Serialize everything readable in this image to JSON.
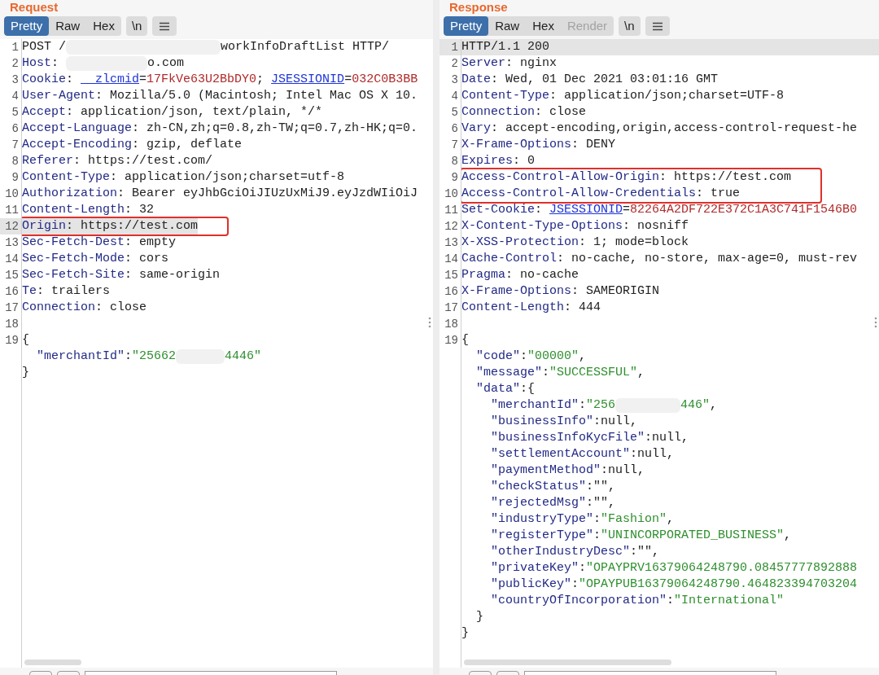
{
  "panels": [
    {
      "title": "Request",
      "tabs": [
        {
          "label": "Pretty",
          "selected": true,
          "disabled": false
        },
        {
          "label": "Raw",
          "selected": false,
          "disabled": false
        },
        {
          "label": "Hex",
          "selected": false,
          "disabled": false
        }
      ],
      "newline_button": "\\n",
      "lines": [
        {
          "n": "1",
          "highlighted": false,
          "boxed": false,
          "segments": [
            {
              "kind": "plain",
              "text": "POST /"
            },
            {
              "kind": "redacted"
            },
            {
              "kind": "plain",
              "text": "workInfoDraftList HTTP/"
            }
          ]
        },
        {
          "n": "2",
          "highlighted": false,
          "boxed": false,
          "segments": [
            {
              "kind": "key",
              "text": "Host"
            },
            {
              "kind": "plain",
              "text": ": "
            },
            {
              "kind": "redacted"
            },
            {
              "kind": "plain",
              "text": "o.com"
            }
          ]
        },
        {
          "n": "3",
          "highlighted": false,
          "boxed": false,
          "segments": [
            {
              "kind": "key",
              "text": "Cookie"
            },
            {
              "kind": "plain",
              "text": ": "
            },
            {
              "kind": "cookie-name",
              "text": "__zlcmid"
            },
            {
              "kind": "plain",
              "text": "="
            },
            {
              "kind": "cookie-value",
              "text": "17FkVe63U2BbDY0"
            },
            {
              "kind": "plain",
              "text": "; "
            },
            {
              "kind": "cookie-name",
              "text": "JSESSIONID"
            },
            {
              "kind": "plain",
              "text": "="
            },
            {
              "kind": "cookie-value",
              "text": "032C0B3BB"
            }
          ]
        },
        {
          "n": "4",
          "highlighted": false,
          "boxed": false,
          "segments": [
            {
              "kind": "key",
              "text": "User-Agent"
            },
            {
              "kind": "plain",
              "text": ": Mozilla/5.0 (Macintosh; Intel Mac OS X 10."
            }
          ]
        },
        {
          "n": "5",
          "highlighted": false,
          "boxed": false,
          "segments": [
            {
              "kind": "key",
              "text": "Accept"
            },
            {
              "kind": "plain",
              "text": ": application/json, text/plain, */*"
            }
          ]
        },
        {
          "n": "6",
          "highlighted": false,
          "boxed": false,
          "segments": [
            {
              "kind": "key",
              "text": "Accept-Language"
            },
            {
              "kind": "plain",
              "text": ": zh-CN,zh;q=0.8,zh-TW;q=0.7,zh-HK;q=0."
            }
          ]
        },
        {
          "n": "7",
          "highlighted": false,
          "boxed": false,
          "segments": [
            {
              "kind": "key",
              "text": "Accept-Encoding"
            },
            {
              "kind": "plain",
              "text": ": gzip, deflate"
            }
          ]
        },
        {
          "n": "8",
          "highlighted": false,
          "boxed": false,
          "segments": [
            {
              "kind": "key",
              "text": "Referer"
            },
            {
              "kind": "plain",
              "text": ": https://test.com/"
            }
          ]
        },
        {
          "n": "9",
          "highlighted": false,
          "boxed": false,
          "segments": [
            {
              "kind": "key",
              "text": "Content-Type"
            },
            {
              "kind": "plain",
              "text": ": application/json;charset=utf-8"
            }
          ]
        },
        {
          "n": "10",
          "highlighted": false,
          "boxed": false,
          "segments": [
            {
              "kind": "key",
              "text": "Authorization"
            },
            {
              "kind": "plain",
              "text": ": Bearer eyJhbGciOiJIUzUxMiJ9.eyJzdWIiOiJ"
            }
          ]
        },
        {
          "n": "11",
          "highlighted": false,
          "boxed": false,
          "segments": [
            {
              "kind": "key",
              "text": "Content-Length"
            },
            {
              "kind": "plain",
              "text": ": 32"
            }
          ]
        },
        {
          "n": "12",
          "highlighted": true,
          "boxed": true,
          "segments": [
            {
              "kind": "key",
              "text": "Origin"
            },
            {
              "kind": "plain",
              "text": ": https://test.com"
            }
          ]
        },
        {
          "n": "13",
          "highlighted": false,
          "boxed": false,
          "segments": [
            {
              "kind": "key",
              "text": "Sec-Fetch-Dest"
            },
            {
              "kind": "plain",
              "text": ": empty"
            }
          ]
        },
        {
          "n": "14",
          "highlighted": false,
          "boxed": false,
          "segments": [
            {
              "kind": "key",
              "text": "Sec-Fetch-Mode"
            },
            {
              "kind": "plain",
              "text": ": cors"
            }
          ]
        },
        {
          "n": "15",
          "highlighted": false,
          "boxed": false,
          "segments": [
            {
              "kind": "key",
              "text": "Sec-Fetch-Site"
            },
            {
              "kind": "plain",
              "text": ": same-origin"
            }
          ]
        },
        {
          "n": "16",
          "highlighted": false,
          "boxed": false,
          "segments": [
            {
              "kind": "key",
              "text": "Te"
            },
            {
              "kind": "plain",
              "text": ": trailers"
            }
          ]
        },
        {
          "n": "17",
          "highlighted": false,
          "boxed": false,
          "segments": [
            {
              "kind": "key",
              "text": "Connection"
            },
            {
              "kind": "plain",
              "text": ": close"
            }
          ]
        },
        {
          "n": "18",
          "highlighted": false,
          "boxed": false
        },
        {
          "n": "19",
          "highlighted": false,
          "boxed": false,
          "segments": [
            {
              "kind": "plain",
              "text": "{"
            }
          ],
          "children": [
            {
              "highlighted": false,
              "boxed": false,
              "segments": [
                {
                  "kind": "key",
                  "text": "\"merchantId\""
                },
                {
                  "kind": "plain",
                  "text": ":"
                },
                {
                  "kind": "string",
                  "text": "\"25662"
                },
                {
                  "kind": "redacted"
                },
                {
                  "kind": "string",
                  "text": "4446\""
                }
              ]
            }
          ]
        },
        {
          "highlighted": false,
          "boxed": false,
          "segments": [
            {
              "kind": "plain",
              "text": "}"
            }
          ]
        }
      ]
    },
    {
      "title": "Response",
      "tabs": [
        {
          "label": "Pretty",
          "selected": true,
          "disabled": false
        },
        {
          "label": "Raw",
          "selected": false,
          "disabled": false
        },
        {
          "label": "Hex",
          "selected": false,
          "disabled": false
        },
        {
          "label": "Render",
          "selected": false,
          "disabled": true
        }
      ],
      "newline_button": "\\n",
      "lines": [
        {
          "n": "1",
          "highlighted": true,
          "boxed": false,
          "segments": [
            {
              "kind": "plain",
              "text": "HTTP/1.1 200"
            }
          ]
        },
        {
          "n": "2",
          "highlighted": false,
          "boxed": false,
          "segments": [
            {
              "kind": "key",
              "text": "Server"
            },
            {
              "kind": "plain",
              "text": ": nginx"
            }
          ]
        },
        {
          "n": "3",
          "highlighted": false,
          "boxed": false,
          "segments": [
            {
              "kind": "key",
              "text": "Date"
            },
            {
              "kind": "plain",
              "text": ": Wed, 01 Dec 2021 03:01:16 GMT"
            }
          ]
        },
        {
          "n": "4",
          "highlighted": false,
          "boxed": false,
          "segments": [
            {
              "kind": "key",
              "text": "Content-Type"
            },
            {
              "kind": "plain",
              "text": ": application/json;charset=UTF-8"
            }
          ]
        },
        {
          "n": "5",
          "highlighted": false,
          "boxed": false,
          "segments": [
            {
              "kind": "key",
              "text": "Connection"
            },
            {
              "kind": "plain",
              "text": ": close"
            }
          ]
        },
        {
          "n": "6",
          "highlighted": false,
          "boxed": false,
          "segments": [
            {
              "kind": "key",
              "text": "Vary"
            },
            {
              "kind": "plain",
              "text": ": accept-encoding,origin,access-control-request-he"
            }
          ]
        },
        {
          "n": "7",
          "highlighted": false,
          "boxed": false,
          "segments": [
            {
              "kind": "key",
              "text": "X-Frame-Options"
            },
            {
              "kind": "plain",
              "text": ": DENY"
            }
          ]
        },
        {
          "n": "8",
          "highlighted": false,
          "boxed": false,
          "segments": [
            {
              "kind": "key",
              "text": "Expires"
            },
            {
              "kind": "plain",
              "text": ": 0"
            }
          ]
        },
        {
          "n": "9",
          "highlighted": false,
          "boxed": true,
          "segments": [
            {
              "kind": "key",
              "text": "Access-Control-Allow-Origin"
            },
            {
              "kind": "plain",
              "text": ": https://test.com"
            }
          ]
        },
        {
          "n": "10",
          "highlighted": false,
          "boxed": true,
          "segments": [
            {
              "kind": "key",
              "text": "Access-Control-Allow-Credentials"
            },
            {
              "kind": "plain",
              "text": ": true"
            }
          ]
        },
        {
          "n": "11",
          "highlighted": false,
          "boxed": false,
          "segments": [
            {
              "kind": "key",
              "text": "Set-Cookie"
            },
            {
              "kind": "plain",
              "text": ": "
            },
            {
              "kind": "cookie-name",
              "text": "JSESSIONID"
            },
            {
              "kind": "plain",
              "text": "="
            },
            {
              "kind": "cookie-value",
              "text": "82264A2DF722E372C1A3C741F1546B0"
            }
          ]
        },
        {
          "n": "12",
          "highlighted": false,
          "boxed": false,
          "segments": [
            {
              "kind": "key",
              "text": "X-Content-Type-Options"
            },
            {
              "kind": "plain",
              "text": ": nosniff"
            }
          ]
        },
        {
          "n": "13",
          "highlighted": false,
          "boxed": false,
          "segments": [
            {
              "kind": "key",
              "text": "X-XSS-Protection"
            },
            {
              "kind": "plain",
              "text": ": 1; mode=block"
            }
          ]
        },
        {
          "n": "14",
          "highlighted": false,
          "boxed": false,
          "segments": [
            {
              "kind": "key",
              "text": "Cache-Control"
            },
            {
              "kind": "plain",
              "text": ": no-cache, no-store, max-age=0, must-rev"
            }
          ]
        },
        {
          "n": "15",
          "highlighted": false,
          "boxed": false,
          "segments": [
            {
              "kind": "key",
              "text": "Pragma"
            },
            {
              "kind": "plain",
              "text": ": no-cache"
            }
          ]
        },
        {
          "n": "16",
          "highlighted": false,
          "boxed": false,
          "segments": [
            {
              "kind": "key",
              "text": "X-Frame-Options"
            },
            {
              "kind": "plain",
              "text": ": SAMEORIGIN"
            }
          ]
        },
        {
          "n": "17",
          "highlighted": false,
          "boxed": false,
          "segments": [
            {
              "kind": "key",
              "text": "Content-Length"
            },
            {
              "kind": "plain",
              "text": ": 444"
            }
          ]
        },
        {
          "n": "18",
          "highlighted": false,
          "boxed": false
        },
        {
          "n": "19",
          "highlighted": false,
          "boxed": false,
          "segments": [
            {
              "kind": "plain",
              "text": "{"
            }
          ],
          "children": [
            {
              "highlighted": false,
              "boxed": false,
              "segments": [
                {
                  "kind": "key",
                  "text": "\"code\""
                },
                {
                  "kind": "plain",
                  "text": ":"
                },
                {
                  "kind": "string",
                  "text": "\"00000\""
                },
                {
                  "kind": "plain",
                  "text": ","
                }
              ]
            },
            {
              "highlighted": false,
              "boxed": false,
              "segments": [
                {
                  "kind": "key",
                  "text": "\"message\""
                },
                {
                  "kind": "plain",
                  "text": ":"
                },
                {
                  "kind": "string",
                  "text": "\"SUCCESSFUL\""
                },
                {
                  "kind": "plain",
                  "text": ","
                }
              ]
            },
            {
              "highlighted": false,
              "boxed": false,
              "segments": [
                {
                  "kind": "key",
                  "text": "\"data\""
                },
                {
                  "kind": "plain",
                  "text": ":{"
                }
              ],
              "children": [
                {
                  "highlighted": false,
                  "boxed": false,
                  "segments": [
                    {
                      "kind": "key",
                      "text": "\"merchantId\""
                    },
                    {
                      "kind": "plain",
                      "text": ":"
                    },
                    {
                      "kind": "string",
                      "text": "\"256"
                    },
                    {
                      "kind": "redacted"
                    },
                    {
                      "kind": "string",
                      "text": "446\""
                    },
                    {
                      "kind": "plain",
                      "text": ","
                    }
                  ]
                },
                {
                  "highlighted": false,
                  "boxed": false,
                  "segments": [
                    {
                      "kind": "key",
                      "text": "\"businessInfo\""
                    },
                    {
                      "kind": "plain",
                      "text": ":null,"
                    }
                  ]
                },
                {
                  "highlighted": false,
                  "boxed": false,
                  "segments": [
                    {
                      "kind": "key",
                      "text": "\"businessInfoKycFile\""
                    },
                    {
                      "kind": "plain",
                      "text": ":null,"
                    }
                  ]
                },
                {
                  "highlighted": false,
                  "boxed": false,
                  "segments": [
                    {
                      "kind": "key",
                      "text": "\"settlementAccount\""
                    },
                    {
                      "kind": "plain",
                      "text": ":null,"
                    }
                  ]
                },
                {
                  "highlighted": false,
                  "boxed": false,
                  "segments": [
                    {
                      "kind": "key",
                      "text": "\"paymentMethod\""
                    },
                    {
                      "kind": "plain",
                      "text": ":null,"
                    }
                  ]
                },
                {
                  "highlighted": false,
                  "boxed": false,
                  "segments": [
                    {
                      "kind": "key",
                      "text": "\"checkStatus\""
                    },
                    {
                      "kind": "plain",
                      "text": ":\"\","
                    }
                  ]
                },
                {
                  "highlighted": false,
                  "boxed": false,
                  "segments": [
                    {
                      "kind": "key",
                      "text": "\"rejectedMsg\""
                    },
                    {
                      "kind": "plain",
                      "text": ":\"\","
                    }
                  ]
                },
                {
                  "highlighted": false,
                  "boxed": false,
                  "segments": [
                    {
                      "kind": "key",
                      "text": "\"industryType\""
                    },
                    {
                      "kind": "plain",
                      "text": ":"
                    },
                    {
                      "kind": "string",
                      "text": "\"Fashion\""
                    },
                    {
                      "kind": "plain",
                      "text": ","
                    }
                  ]
                },
                {
                  "highlighted": false,
                  "boxed": false,
                  "segments": [
                    {
                      "kind": "key",
                      "text": "\"registerType\""
                    },
                    {
                      "kind": "plain",
                      "text": ":"
                    },
                    {
                      "kind": "string",
                      "text": "\"UNINCORPORATED_BUSINESS\""
                    },
                    {
                      "kind": "plain",
                      "text": ","
                    }
                  ]
                },
                {
                  "highlighted": false,
                  "boxed": false,
                  "segments": [
                    {
                      "kind": "key",
                      "text": "\"otherIndustryDesc\""
                    },
                    {
                      "kind": "plain",
                      "text": ":\"\","
                    }
                  ]
                },
                {
                  "highlighted": false,
                  "boxed": false,
                  "segments": [
                    {
                      "kind": "key",
                      "text": "\"privateKey\""
                    },
                    {
                      "kind": "plain",
                      "text": ":"
                    },
                    {
                      "kind": "string",
                      "text": "\"OPAYPRV16379064248790.08457777892888"
                    }
                  ]
                },
                {
                  "highlighted": false,
                  "boxed": false,
                  "segments": [
                    {
                      "kind": "key",
                      "text": "\"publicKey\""
                    },
                    {
                      "kind": "plain",
                      "text": ":"
                    },
                    {
                      "kind": "string",
                      "text": "\"OPAYPUB16379064248790.464823394703204"
                    }
                  ]
                },
                {
                  "highlighted": false,
                  "boxed": false,
                  "segments": [
                    {
                      "kind": "key",
                      "text": "\"countryOfIncorporation\""
                    },
                    {
                      "kind": "plain",
                      "text": ":"
                    },
                    {
                      "kind": "string",
                      "text": "\"International\""
                    }
                  ]
                }
              ]
            },
            {
              "highlighted": false,
              "boxed": false,
              "segments": [
                {
                  "kind": "plain",
                  "text": "}"
                }
              ]
            }
          ]
        },
        {
          "highlighted": false,
          "boxed": false,
          "segments": [
            {
              "kind": "plain",
              "text": "}"
            }
          ]
        }
      ]
    }
  ]
}
